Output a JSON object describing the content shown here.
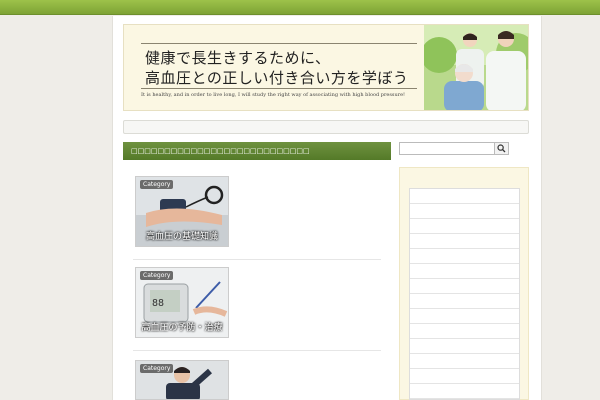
{
  "header": {
    "title_line1": "健康で長生きするために、",
    "title_line2": "高血圧との正しい付き合い方を学ぼう",
    "subtitle": "It is healthy, and in order to live long, I will study the right way of associating with high blood pressure!"
  },
  "main": {
    "heading": "□□□□□□□□□□□□□□□□□□□□□□□□□□□",
    "categories": [
      {
        "tag": "Category",
        "caption": "高血圧の基礎知識",
        "icon": "blood-pressure-cuff"
      },
      {
        "tag": "Category",
        "caption": "高血圧の予防・治療",
        "icon": "blood-pressure-monitor"
      },
      {
        "tag": "Category",
        "caption": "",
        "icon": "businessman"
      }
    ]
  },
  "sidebar": {
    "search": {
      "placeholder": "",
      "button_icon": "search-icon"
    },
    "list_rows": 14
  },
  "colors": {
    "topbar": "#8db13f",
    "heading_bg": "#5f8533",
    "header_bg": "#fbf7e3",
    "sidebar_bg": "#fbf7e3"
  }
}
